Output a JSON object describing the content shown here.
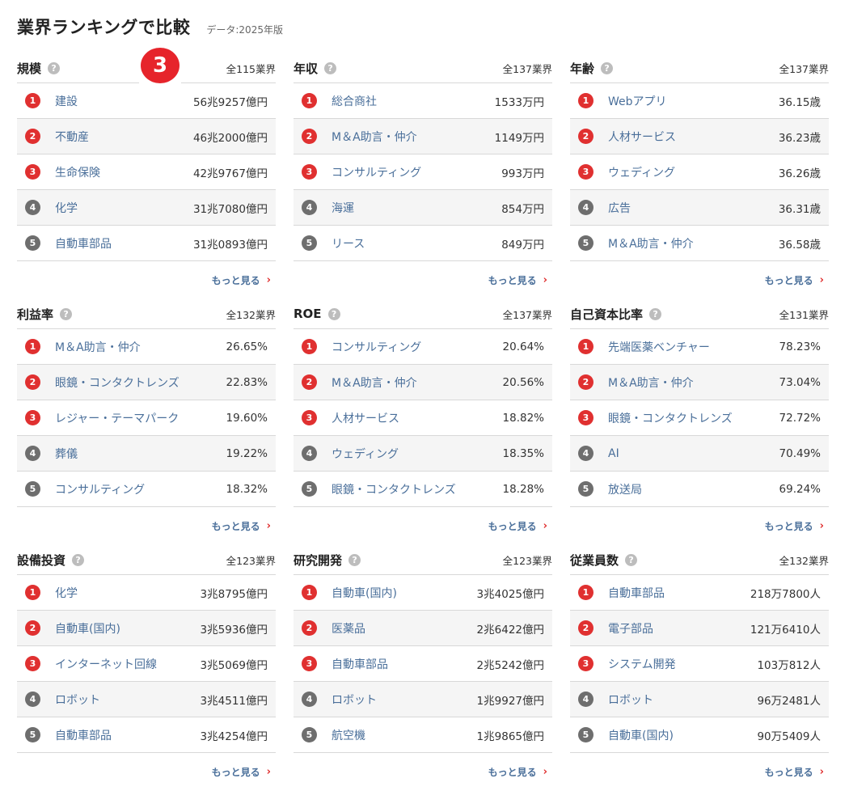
{
  "header": {
    "title": "業界ランキングで比較",
    "subtitle": "データ:2025年版"
  },
  "step_marker": "3",
  "more_label": "もっと見る",
  "cards": [
    {
      "title": "規模",
      "count": "全115業界",
      "items": [
        {
          "rank": "1",
          "name": "建設",
          "value": "56兆9257億円"
        },
        {
          "rank": "2",
          "name": "不動産",
          "value": "46兆2000億円"
        },
        {
          "rank": "3",
          "name": "生命保険",
          "value": "42兆9767億円"
        },
        {
          "rank": "4",
          "name": "化学",
          "value": "31兆7080億円"
        },
        {
          "rank": "5",
          "name": "自動車部品",
          "value": "31兆0893億円"
        }
      ]
    },
    {
      "title": "年収",
      "count": "全137業界",
      "items": [
        {
          "rank": "1",
          "name": "総合商社",
          "value": "1533万円"
        },
        {
          "rank": "2",
          "name": "M＆A助言・仲介",
          "value": "1149万円"
        },
        {
          "rank": "3",
          "name": "コンサルティング",
          "value": "993万円"
        },
        {
          "rank": "4",
          "name": "海運",
          "value": "854万円"
        },
        {
          "rank": "5",
          "name": "リース",
          "value": "849万円"
        }
      ]
    },
    {
      "title": "年齢",
      "count": "全137業界",
      "items": [
        {
          "rank": "1",
          "name": "Webアプリ",
          "value": "36.15歳"
        },
        {
          "rank": "2",
          "name": "人材サービス",
          "value": "36.23歳"
        },
        {
          "rank": "3",
          "name": "ウェディング",
          "value": "36.26歳"
        },
        {
          "rank": "4",
          "name": "広告",
          "value": "36.31歳"
        },
        {
          "rank": "5",
          "name": "M＆A助言・仲介",
          "value": "36.58歳"
        }
      ]
    },
    {
      "title": "利益率",
      "count": "全132業界",
      "items": [
        {
          "rank": "1",
          "name": "M＆A助言・仲介",
          "value": "26.65%"
        },
        {
          "rank": "2",
          "name": "眼鏡・コンタクトレンズ",
          "value": "22.83%"
        },
        {
          "rank": "3",
          "name": "レジャー・テーマパーク",
          "value": "19.60%"
        },
        {
          "rank": "4",
          "name": "葬儀",
          "value": "19.22%"
        },
        {
          "rank": "5",
          "name": "コンサルティング",
          "value": "18.32%"
        }
      ]
    },
    {
      "title": "ROE",
      "count": "全137業界",
      "items": [
        {
          "rank": "1",
          "name": "コンサルティング",
          "value": "20.64%"
        },
        {
          "rank": "2",
          "name": "M＆A助言・仲介",
          "value": "20.56%"
        },
        {
          "rank": "3",
          "name": "人材サービス",
          "value": "18.82%"
        },
        {
          "rank": "4",
          "name": "ウェディング",
          "value": "18.35%"
        },
        {
          "rank": "5",
          "name": "眼鏡・コンタクトレンズ",
          "value": "18.28%"
        }
      ]
    },
    {
      "title": "自己資本比率",
      "count": "全131業界",
      "items": [
        {
          "rank": "1",
          "name": "先端医薬ベンチャー",
          "value": "78.23%"
        },
        {
          "rank": "2",
          "name": "M＆A助言・仲介",
          "value": "73.04%"
        },
        {
          "rank": "3",
          "name": "眼鏡・コンタクトレンズ",
          "value": "72.72%"
        },
        {
          "rank": "4",
          "name": "AI",
          "value": "70.49%"
        },
        {
          "rank": "5",
          "name": "放送局",
          "value": "69.24%"
        }
      ]
    },
    {
      "title": "設備投資",
      "count": "全123業界",
      "items": [
        {
          "rank": "1",
          "name": "化学",
          "value": "3兆8795億円"
        },
        {
          "rank": "2",
          "name": "自動車(国内)",
          "value": "3兆5936億円"
        },
        {
          "rank": "3",
          "name": "インターネット回線",
          "value": "3兆5069億円"
        },
        {
          "rank": "4",
          "name": "ロボット",
          "value": "3兆4511億円"
        },
        {
          "rank": "5",
          "name": "自動車部品",
          "value": "3兆4254億円"
        }
      ]
    },
    {
      "title": "研究開発",
      "count": "全123業界",
      "items": [
        {
          "rank": "1",
          "name": "自動車(国内)",
          "value": "3兆4025億円"
        },
        {
          "rank": "2",
          "name": "医薬品",
          "value": "2兆6422億円"
        },
        {
          "rank": "3",
          "name": "自動車部品",
          "value": "2兆5242億円"
        },
        {
          "rank": "4",
          "name": "ロボット",
          "value": "1兆9927億円"
        },
        {
          "rank": "5",
          "name": "航空機",
          "value": "1兆9865億円"
        }
      ]
    },
    {
      "title": "従業員数",
      "count": "全132業界",
      "items": [
        {
          "rank": "1",
          "name": "自動車部品",
          "value": "218万7800人"
        },
        {
          "rank": "2",
          "name": "電子部品",
          "value": "121万6410人"
        },
        {
          "rank": "3",
          "name": "システム開発",
          "value": "103万812人"
        },
        {
          "rank": "4",
          "name": "ロボット",
          "value": "96万2481人"
        },
        {
          "rank": "5",
          "name": "自動車(国内)",
          "value": "90万5409人"
        }
      ]
    }
  ]
}
